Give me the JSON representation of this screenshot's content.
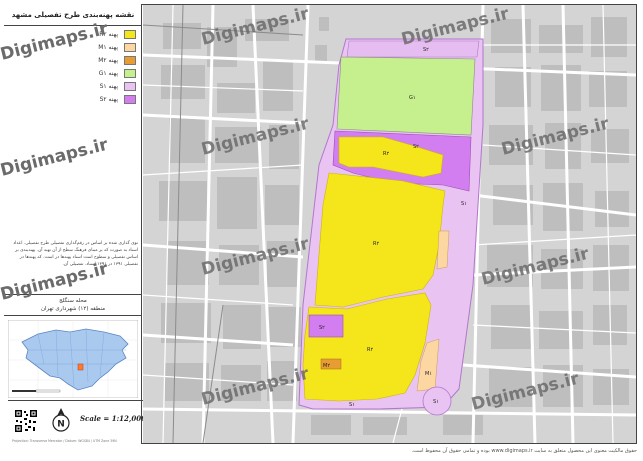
{
  "title": "نقشه پهنه‌بندی طرح تفصیلی مشهد",
  "legend": [
    {
      "code": "R۲",
      "label": "پهنه",
      "color": "#f5e61c"
    },
    {
      "code": "M۱",
      "label": "پهنه",
      "color": "#fcd7a2"
    },
    {
      "code": "M۲",
      "label": "پهنه",
      "color": "#e89c34"
    },
    {
      "code": "G۱",
      "label": "پهنه",
      "color": "#c6f08d"
    },
    {
      "code": "S۱",
      "label": "پهنه",
      "color": "#e9c3f2"
    },
    {
      "code": "S۲",
      "label": "پهنه",
      "color": "#d37ef0"
    }
  ],
  "description": "توی گذاری شده بر اساس در رقم‌گذاری تفصیلی طرح تفصیلی. اعداد اسناد به صورت که بر مبنای فرهنگ سطح از آن تهیه آن. پهنه‌بندی بر اساس تفصیلی و سطوح است اسناد پهنه‌ها در است. که پهنه‌ها در تفصیلی ۱۳۹۱ در ۱۳۹۱ اسناد. تفصیلی آن.",
  "location": {
    "line1": "محله سنگلج",
    "line2": "منطقه (۱۲) شهرداری تهران"
  },
  "scale": "Scale = 1:12,000",
  "north_label": "N",
  "credit_line": "Projection: Transverse Mercator / Datum: WGS84 / UTM Zone 39N",
  "watermark": "Digimaps.ir",
  "bottom_note": "حقوق مالکیت معنوی این محصول متعلق به سایت www.digimaps.ir بوده و تمامی حقوق آن محفوظ است.",
  "zone_labels": {
    "top_strip": "S۲",
    "green": "G۱",
    "purple_band": "S۲",
    "right_strip": "S۱",
    "yellow_a": "R۲",
    "yellow_b": "R۲",
    "yellow_c": "R۲",
    "orange_right": "M۱",
    "orange_small": "M۲",
    "purple_block": "S۲",
    "bottom_strip": "S۱",
    "circle": "S۱"
  },
  "colors": {
    "map_bg": "#d4d4d4",
    "road": "#ffffff",
    "building": "#bdbdbd",
    "outline": "#9b4fb0"
  }
}
